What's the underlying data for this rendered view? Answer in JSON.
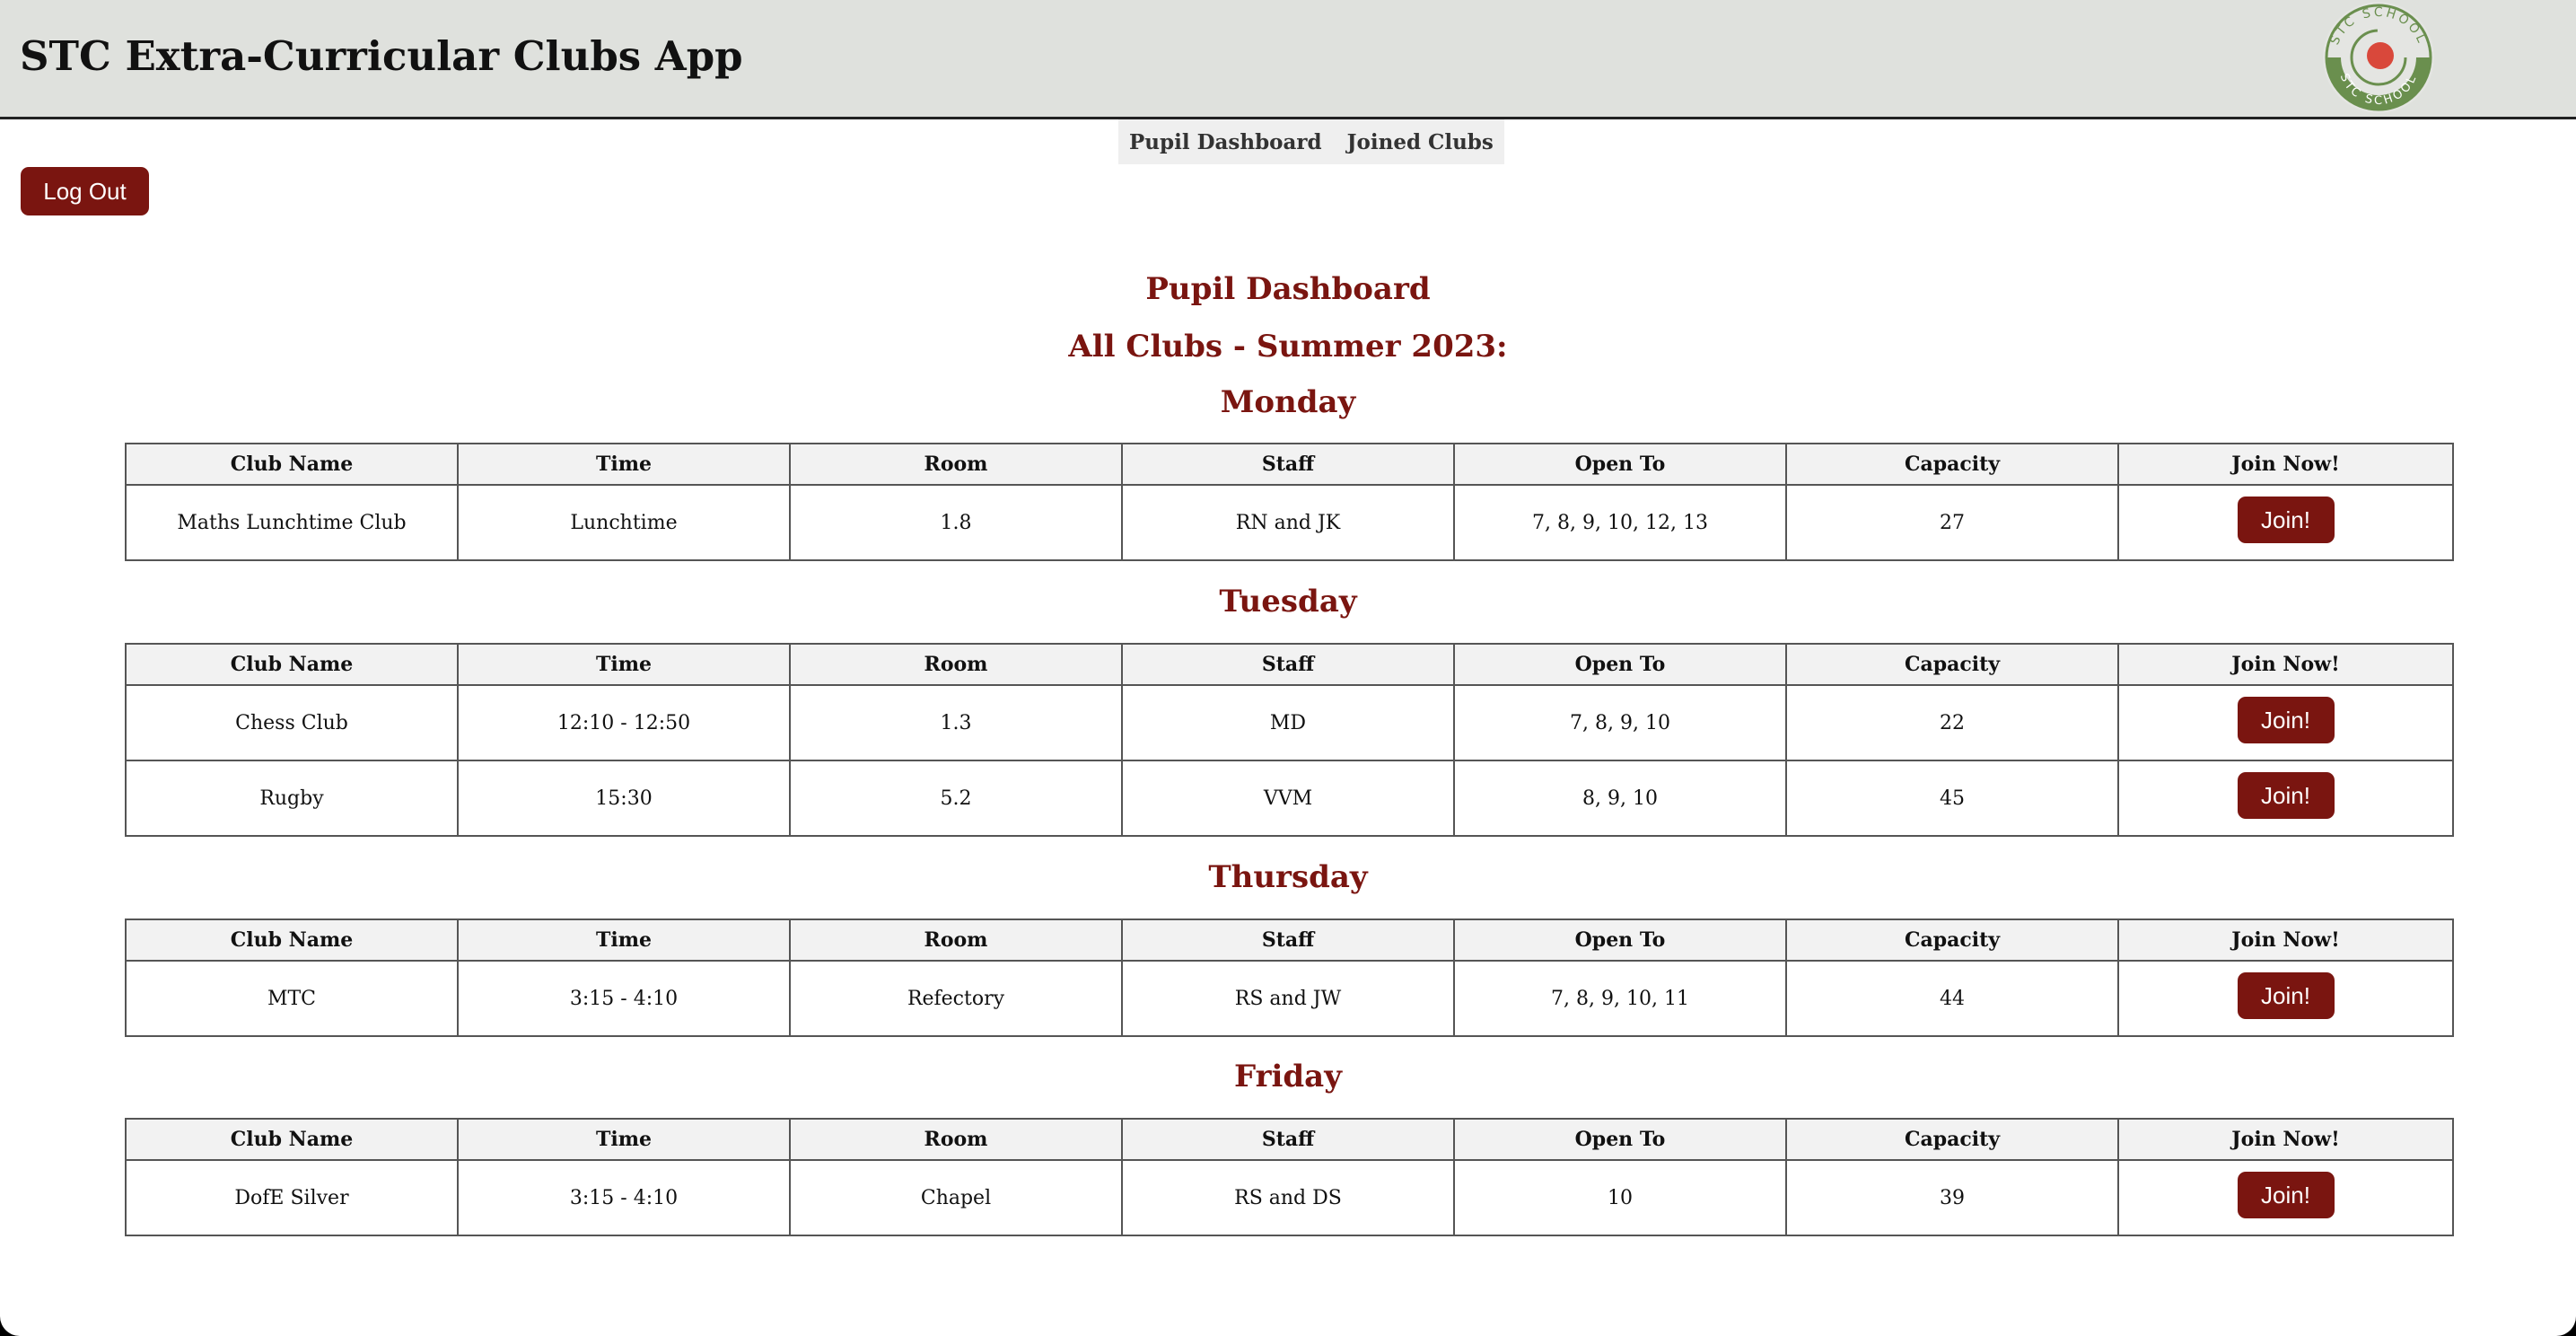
{
  "app": {
    "title": "STC Extra-Curricular Clubs App",
    "logo_text_top": "STC SCHOOL",
    "logo_text_bottom": "STC SCHOOL"
  },
  "nav": {
    "items": [
      {
        "label": "Pupil Dashboard"
      },
      {
        "label": "Joined Clubs"
      }
    ]
  },
  "logout_label": "Log Out",
  "headings": {
    "page": "Pupil Dashboard",
    "subtitle": "All Clubs - Summer 2023:"
  },
  "columns": [
    "Club Name",
    "Time",
    "Room",
    "Staff",
    "Open To",
    "Capacity",
    "Join Now!"
  ],
  "join_label": "Join!",
  "days": [
    {
      "name": "Monday",
      "clubs": [
        {
          "club_name": "Maths Lunchtime Club",
          "time": "Lunchtime",
          "room": "1.8",
          "staff": "RN and JK",
          "open_to": "7, 8, 9, 10, 12, 13",
          "capacity": "27"
        }
      ]
    },
    {
      "name": "Tuesday",
      "clubs": [
        {
          "club_name": "Chess Club",
          "time": "12:10 - 12:50",
          "room": "1.3",
          "staff": "MD",
          "open_to": "7, 8, 9, 10",
          "capacity": "22"
        },
        {
          "club_name": "Rugby",
          "time": "15:30",
          "room": "5.2",
          "staff": "VVM",
          "open_to": "8, 9, 10",
          "capacity": "45"
        }
      ]
    },
    {
      "name": "Thursday",
      "clubs": [
        {
          "club_name": "MTC",
          "time": "3:15 - 4:10",
          "room": "Refectory",
          "staff": "RS and JW",
          "open_to": "7, 8, 9, 10, 11",
          "capacity": "44"
        }
      ]
    },
    {
      "name": "Friday",
      "clubs": [
        {
          "club_name": "DofE Silver",
          "time": "3:15 - 4:10",
          "room": "Chapel",
          "staff": "RS and DS",
          "open_to": "10",
          "capacity": "39"
        }
      ]
    }
  ],
  "colors": {
    "accent": "#7a1510",
    "header_bg": "#dfe1dd",
    "logo_green": "#6a8f4e",
    "logo_red": "#d9483b"
  }
}
